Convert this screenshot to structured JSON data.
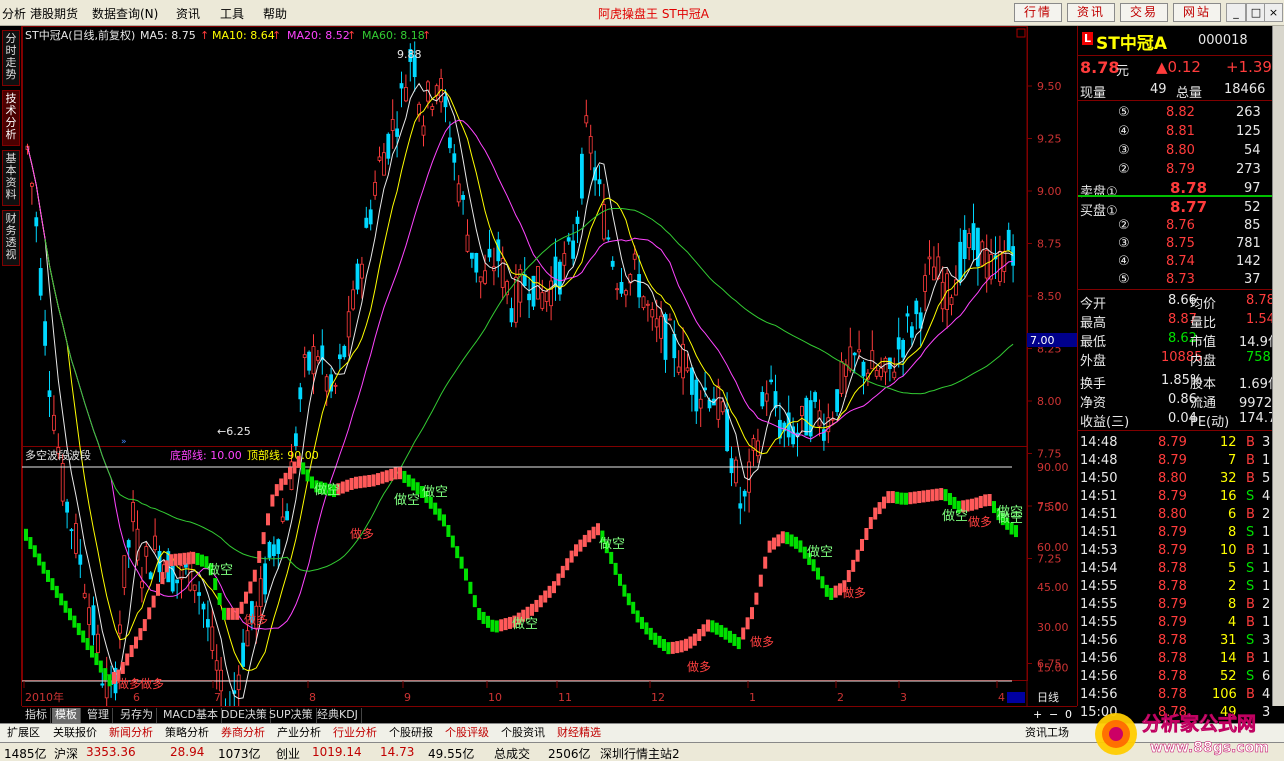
{
  "menu": {
    "items": [
      "分析",
      "港股期货",
      "数据查询(N)",
      "资讯",
      "工具",
      "帮助"
    ],
    "app_title": "阿虎操盘王 ST中冠A",
    "buttons": [
      "行情",
      "资讯",
      "交易",
      "网站"
    ],
    "win": [
      "_",
      "□",
      "×"
    ]
  },
  "left_tabs": [
    "分时走势",
    "技术分析",
    "基本资料",
    "财务透视"
  ],
  "main_chart": {
    "header": "ST中冠A(日线,前复权)",
    "ma_labels": [
      {
        "text": "MA5: 8.75",
        "color": "#e8e8e8"
      },
      {
        "text": "MA10: 8.64",
        "color": "#ffff00"
      },
      {
        "text": "MA20: 8.52",
        "color": "#ff44ff"
      },
      {
        "text": "MA60: 8.18",
        "color": "#33cc33"
      }
    ],
    "high_label": "9.88",
    "low_label": "←6.25",
    "price_axis": [
      "9.50",
      "9.25",
      "9.00",
      "8.75",
      "8.50",
      "8.25",
      "8.00",
      "7.75",
      "7.50",
      "7.25",
      "7.00",
      "6.75",
      "6.50"
    ],
    "current_price_tag": "7.00"
  },
  "indicator": {
    "name": "多空波段波段",
    "bottom_label": "底部线: 10.00",
    "top_label": "顶部线: 90.00",
    "axis": [
      "90.00",
      "75.00",
      "60.00",
      "45.00",
      "30.00",
      "15.00"
    ],
    "signals": [
      {
        "text": "做空",
        "kind": "short",
        "x": 0.3
      },
      {
        "text": "做多",
        "kind": "long"
      },
      {
        "text": "做空",
        "kind": "short"
      },
      {
        "text": "做多",
        "kind": "long"
      },
      {
        "text": "做空",
        "kind": "short"
      },
      {
        "text": "做空",
        "kind": "short"
      },
      {
        "text": "做多",
        "kind": "long"
      },
      {
        "text": "做空",
        "kind": "short"
      },
      {
        "text": "做多",
        "kind": "long"
      },
      {
        "text": "做空",
        "kind": "short"
      },
      {
        "text": "做多",
        "kind": "long"
      },
      {
        "text": "做空",
        "kind": "short"
      },
      {
        "text": "做多",
        "kind": "long"
      },
      {
        "text": "做空",
        "kind": "short"
      },
      {
        "text": "做多",
        "kind": "long"
      },
      {
        "text": "做空",
        "kind": "short"
      },
      {
        "text": "做多",
        "kind": "long"
      },
      {
        "text": "做空",
        "kind": "short"
      }
    ]
  },
  "time_axis": [
    "2010年",
    "6",
    "7",
    "8",
    "9",
    "10",
    "11",
    "12",
    "1",
    "2",
    "3",
    "4"
  ],
  "period_label": "日线",
  "right_panel": {
    "code_badge": "L",
    "name": "ST中冠A",
    "code": "000018",
    "price": "8.78",
    "price_unit": "元",
    "change": "▲0.12",
    "change_pct": "+1.39",
    "vol_label": "现量",
    "vol": "49",
    "total_label": "总量",
    "total": "18466",
    "asks": [
      {
        "lvl": "⑤",
        "price": "8.82",
        "vol": "263"
      },
      {
        "lvl": "④",
        "price": "8.81",
        "vol": "125"
      },
      {
        "lvl": "③",
        "price": "8.80",
        "vol": "54"
      },
      {
        "lvl": "②",
        "price": "8.79",
        "vol": "273"
      },
      {
        "lvl": "卖盘①",
        "price": "8.78",
        "vol": "97"
      }
    ],
    "bids": [
      {
        "lvl": "买盘①",
        "price": "8.77",
        "vol": "52"
      },
      {
        "lvl": "②",
        "price": "8.76",
        "vol": "85"
      },
      {
        "lvl": "③",
        "price": "8.75",
        "vol": "781"
      },
      {
        "lvl": "④",
        "price": "8.74",
        "vol": "142"
      },
      {
        "lvl": "⑤",
        "price": "8.73",
        "vol": "37"
      }
    ],
    "stats": [
      {
        "l1": "今开",
        "v1": "8.66",
        "c1": "white",
        "l2": "均价",
        "v2": "8.78",
        "c2": "red"
      },
      {
        "l1": "最高",
        "v1": "8.87",
        "c1": "red",
        "l2": "量比",
        "v2": "1.54",
        "c2": "red"
      },
      {
        "l1": "最低",
        "v1": "8.62",
        "c1": "green",
        "l2": "市值",
        "v2": "14.9亿",
        "c2": "white"
      },
      {
        "l1": "外盘",
        "v1": "10885",
        "c1": "red",
        "l2": "内盘",
        "v2": "7581",
        "c2": "green"
      },
      {
        "l1": "换手",
        "v1": "1.85%",
        "c1": "white",
        "l2": "股本",
        "v2": "1.69亿",
        "c2": "white"
      },
      {
        "l1": "净资",
        "v1": "0.86",
        "c1": "white",
        "l2": "流通",
        "v2": "9972万",
        "c2": "white"
      },
      {
        "l1": "收益(三)",
        "v1": "0.04",
        "c1": "white",
        "l2": "PE(动)",
        "v2": "174.7",
        "c2": "white"
      }
    ],
    "ticks": [
      {
        "t": "14:48",
        "p": "8.79",
        "v": "12",
        "s": "B",
        "n": "3"
      },
      {
        "t": "14:48",
        "p": "8.79",
        "v": "7",
        "s": "B",
        "n": "1"
      },
      {
        "t": "14:50",
        "p": "8.80",
        "v": "32",
        "s": "B",
        "n": "5"
      },
      {
        "t": "14:51",
        "p": "8.79",
        "v": "16",
        "s": "S",
        "n": "4"
      },
      {
        "t": "14:51",
        "p": "8.80",
        "v": "6",
        "s": "B",
        "n": "2"
      },
      {
        "t": "14:51",
        "p": "8.79",
        "v": "8",
        "s": "S",
        "n": "1"
      },
      {
        "t": "14:53",
        "p": "8.79",
        "v": "10",
        "s": "B",
        "n": "1"
      },
      {
        "t": "14:54",
        "p": "8.78",
        "v": "5",
        "s": "S",
        "n": "1"
      },
      {
        "t": "14:55",
        "p": "8.78",
        "v": "2",
        "s": "S",
        "n": "1"
      },
      {
        "t": "14:55",
        "p": "8.79",
        "v": "8",
        "s": "B",
        "n": "2"
      },
      {
        "t": "14:55",
        "p": "8.79",
        "v": "4",
        "s": "B",
        "n": "1"
      },
      {
        "t": "14:56",
        "p": "8.78",
        "v": "31",
        "s": "S",
        "n": "3"
      },
      {
        "t": "14:56",
        "p": "8.78",
        "v": "14",
        "s": "B",
        "n": "1"
      },
      {
        "t": "14:56",
        "p": "8.78",
        "v": "52",
        "s": "S",
        "n": "6"
      },
      {
        "t": "14:56",
        "p": "8.78",
        "v": "106",
        "s": "B",
        "n": "4"
      },
      {
        "t": "15:00",
        "p": "8.78",
        "v": "49",
        "s": "",
        "n": "3"
      }
    ]
  },
  "bottom_tabs": [
    "指标",
    "模板",
    "管理",
    "另存为",
    "MACD基本",
    "DDE决策",
    "SUP决策",
    "经典KDJ"
  ],
  "active_bottom_tab": 1,
  "func_bar": [
    "扩展区",
    "关联报价",
    "新闻分析",
    "策略分析",
    "券商分析",
    "产业分析",
    "行业分析",
    "个股研报",
    "个股评级",
    "个股资讯",
    "财经精选"
  ],
  "func_right": "资讯工场",
  "status": {
    "a": "1485亿",
    "b_label": "沪深",
    "b_val": "3353.36",
    "c": "28.94",
    "d": "1073亿",
    "e_label": "创业",
    "e_val": "1019.14",
    "f": "14.73",
    "g": "49.55亿",
    "h_label": "总成交",
    "h_val": "2506亿",
    "i": "深圳行情主站2"
  },
  "logo": {
    "title": "分析家公式网",
    "url": "www.88gs.com"
  },
  "colors": {
    "up": "#ff3c3c",
    "down": "#00e000",
    "ma5": "#e8e8e8",
    "ma10": "#ffff00",
    "ma20": "#ff44ff",
    "ma60": "#33cc33",
    "frame": "#800000"
  }
}
